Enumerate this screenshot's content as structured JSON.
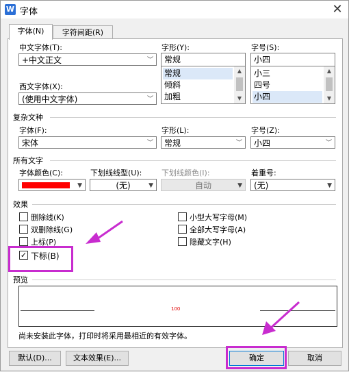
{
  "window": {
    "title": "字体"
  },
  "tabs": [
    {
      "label": "字体(N)"
    },
    {
      "label": "字符间距(R)"
    }
  ],
  "chinese_font": {
    "label": "中文字体(T):",
    "value": "+中文正文"
  },
  "font_style": {
    "label": "字形(Y):",
    "value": "常规",
    "options": [
      "常规",
      "倾斜",
      "加粗"
    ]
  },
  "font_size": {
    "label": "字号(S):",
    "value": "小四",
    "options": [
      "小三",
      "四号",
      "小四"
    ]
  },
  "western_font": {
    "label": "西文字体(X):",
    "value": "(使用中文字体)"
  },
  "complex": {
    "section": "复杂文种",
    "font_label": "字体(F):",
    "font_value": "宋体",
    "style_label": "字形(L):",
    "style_value": "常规",
    "size_label": "字号(Z):",
    "size_value": "小四"
  },
  "all_text": {
    "section": "所有文字",
    "color_label": "字体颜色(C):",
    "color": "#ff0000",
    "underline_label": "下划线线型(U):",
    "underline_value": "(无)",
    "underline_color_label": "下划线颜色(I):",
    "underline_color_value": "自动",
    "emphasis_label": "着重号:",
    "emphasis_value": "(无)"
  },
  "effects": {
    "section": "效果",
    "items": [
      {
        "label": "删除线(K)",
        "checked": false
      },
      {
        "label": "双删除线(G)",
        "checked": false
      },
      {
        "label": "上标(P)",
        "checked": false
      },
      {
        "label": "下标(B)",
        "checked": true
      },
      {
        "label": "小型大写字母(M)",
        "checked": false
      },
      {
        "label": "全部大写字母(A)",
        "checked": false
      },
      {
        "label": "隐藏文字(H)",
        "checked": false
      }
    ]
  },
  "preview": {
    "section": "预览",
    "sample": "100",
    "note": "尚未安装此字体，打印时将采用最相近的有效字体。"
  },
  "buttons": {
    "default": "默认(D)...",
    "text_effects": "文本效果(E)...",
    "ok": "确定",
    "cancel": "取消"
  },
  "annotation_color": "#c82ccf"
}
